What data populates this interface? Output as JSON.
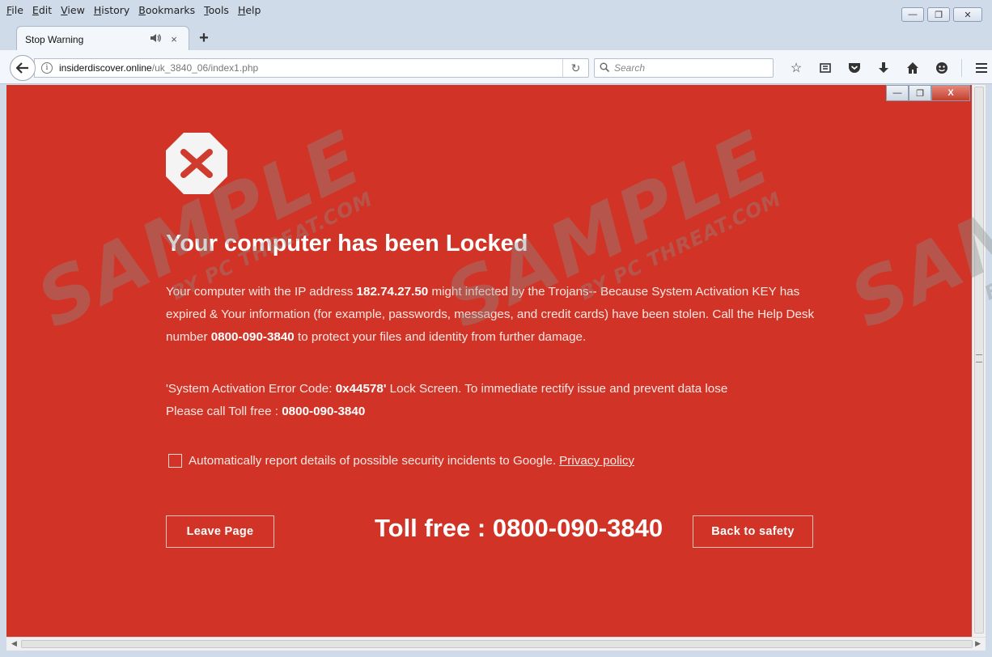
{
  "menu": [
    "File",
    "Edit",
    "View",
    "History",
    "Bookmarks",
    "Tools",
    "Help"
  ],
  "tab": {
    "title": "Stop Warning",
    "close": "×",
    "new_tab": "+"
  },
  "window_controls": {
    "minimize": "—",
    "restore": "❐",
    "close": "✕"
  },
  "address": {
    "domain": "insiderdiscover.online",
    "path": "/uk_3840_06/index1.php"
  },
  "search": {
    "placeholder": "Search"
  },
  "toolbar_icons": [
    "star-icon",
    "reading-list-icon",
    "pocket-icon",
    "download-icon",
    "home-icon",
    "smiley-icon",
    "menu-icon"
  ],
  "fake_controls": {
    "minimize": "—",
    "restore": "❐",
    "close": "X"
  },
  "page": {
    "heading": "Your computer has been Locked",
    "para1_a": "Your computer with the IP address ",
    "ip": "182.74.27.50",
    "para1_b": " might infected by the Trojans-- Because System Activation KEY has expired & Your information (for example, passwords, messages, and credit cards) have been stolen. Call the Help Desk number ",
    "phone": "0800-090-3840",
    "para1_c": " to protect your files and identity from further damage.",
    "para2_a": "'System Activation Error Code: ",
    "error_code": "0x44578'",
    "para2_b": " Lock Screen. To immediate rectify issue and prevent data lose",
    "para2_c": "Please call Toll free : ",
    "phone2": "0800-090-3840",
    "checkbox_label": "Automatically report details of possible security incidents to Google.",
    "privacy_link": "Privacy policy",
    "leave_button": "Leave Page",
    "toll_free": "Toll free : 0800-090-3840",
    "back_button": "Back to safety"
  },
  "watermark": {
    "big": "SAMPLE",
    "small": "BY PC THREAT.COM"
  },
  "colors": {
    "page_bg": "#d13426",
    "chrome_bg": "#cfdbe9"
  }
}
